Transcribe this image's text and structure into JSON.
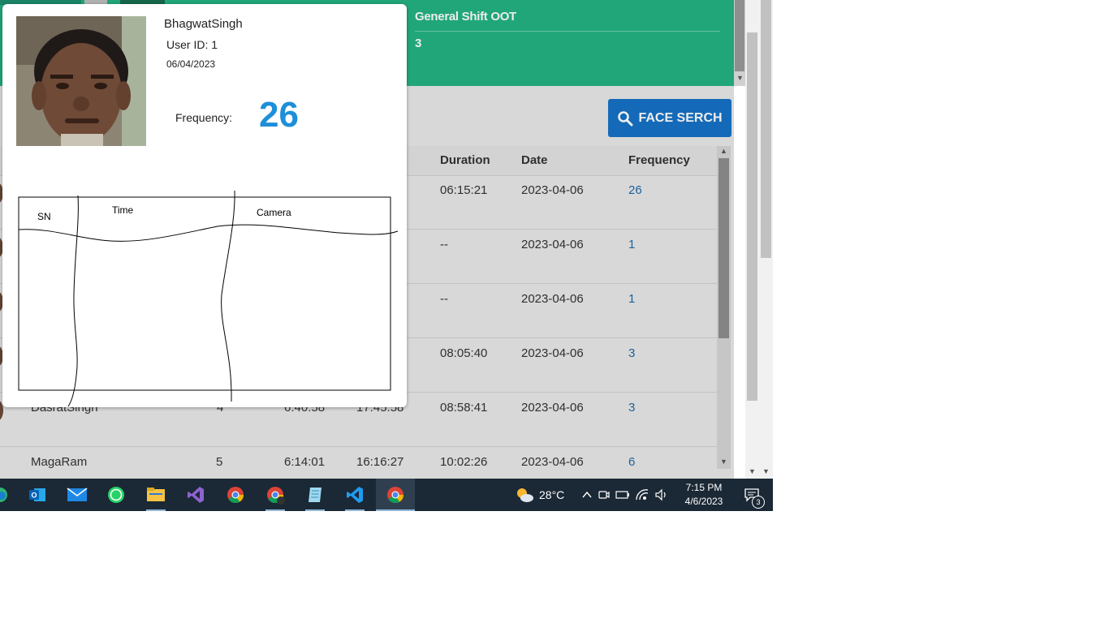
{
  "shift": {
    "label": "General Shift OOT",
    "count": "3"
  },
  "face_button": {
    "label": "FACE SERCH",
    "icon": "search-icon"
  },
  "table": {
    "headers": [
      "Duration",
      "Date",
      "Frequency"
    ],
    "rows": [
      {
        "name": "",
        "sn": "",
        "in_time": "",
        "out_time": "",
        "duration": "06:15:21",
        "date": "2023-04-06",
        "frequency": "26"
      },
      {
        "name": "",
        "sn": "",
        "in_time": "",
        "out_time": "",
        "duration": "--",
        "date": "2023-04-06",
        "frequency": "1"
      },
      {
        "name": "",
        "sn": "",
        "in_time": "",
        "out_time": "",
        "duration": "--",
        "date": "2023-04-06",
        "frequency": "1"
      },
      {
        "name": "",
        "sn": "",
        "in_time": "",
        "out_time": "",
        "duration": "08:05:40",
        "date": "2023-04-06",
        "frequency": "3"
      },
      {
        "name": "DasratSingh",
        "sn": "4",
        "in_time": "6:40:58",
        "out_time": "17:45:58",
        "duration": "08:58:41",
        "date": "2023-04-06",
        "frequency": "3"
      },
      {
        "name": "MagaRam",
        "sn": "5",
        "in_time": "6:14:01",
        "out_time": "16:16:27",
        "duration": "10:02:26",
        "date": "2023-04-06",
        "frequency": "6"
      }
    ]
  },
  "popup": {
    "name": "BhagwatSingh",
    "user_id": "User ID: 1",
    "date": "06/04/2023",
    "frequency_label": "Frequency:",
    "frequency_value": "26",
    "sketch_columns": [
      "SN",
      "Time",
      "Camera"
    ]
  },
  "taskbar": {
    "apps": [
      "edge-icon",
      "outlook-icon",
      "mail-icon",
      "whatsapp-icon",
      "file-explorer-icon",
      "visual-studio-icon",
      "chrome-icon",
      "chrome-profile-icon",
      "notepad-icon",
      "vscode-icon",
      "chrome-active-icon"
    ],
    "temperature": "28°C",
    "time": "7:15 PM",
    "date": "4/6/2023",
    "notifications": "3"
  },
  "colors": {
    "header_green": "#24b383",
    "button_blue": "#1673c6",
    "frequency_blue": "#1e8fd9",
    "link_blue": "#1f6aa8",
    "taskbar": "#1b2835"
  }
}
